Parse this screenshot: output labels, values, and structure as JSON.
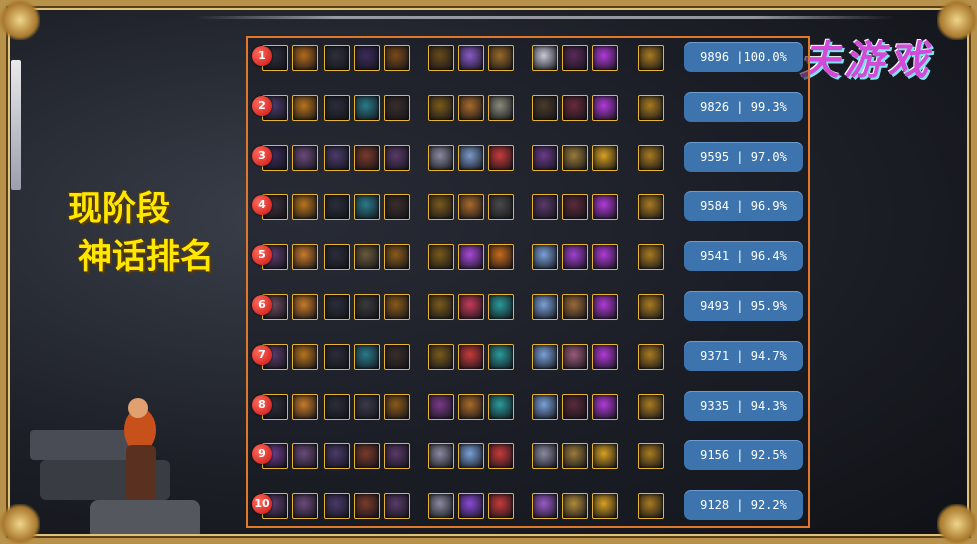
{
  "brand": {
    "text": "夫游戏"
  },
  "side_title": {
    "line1": "现阶段",
    "line2": "神话排名"
  },
  "colors": {
    "frame_gold": "#b8924a",
    "panel_border": "#e0772a",
    "score_bg": "#3d74ad",
    "title_yellow": "#ffe800",
    "rank_badge": "#c81414"
  },
  "rows": [
    {
      "rank": "1",
      "score": "9896 |100.0%"
    },
    {
      "rank": "2",
      "score": "9826 | 99.3%"
    },
    {
      "rank": "3",
      "score": "9595 | 97.0%"
    },
    {
      "rank": "4",
      "score": "9584 | 96.9%"
    },
    {
      "rank": "5",
      "score": "9541 | 96.4%"
    },
    {
      "rank": "6",
      "score": "9493 | 95.9%"
    },
    {
      "rank": "7",
      "score": "9371 | 94.7%"
    },
    {
      "rank": "8",
      "score": "9335 | 94.3%"
    },
    {
      "rank": "9",
      "score": "9156 | 92.5%"
    },
    {
      "rank": "10",
      "score": "9128 | 92.2%"
    }
  ],
  "item_palettes": [
    [
      "#2a2d3a",
      "#b36a1c",
      "#2d2f3a",
      "#3a2b5a",
      "#7a4a1a",
      "#6a4a18",
      "#8a5ac8",
      "#9a6a28",
      "#c8c8d8",
      "#5a2a5a",
      "#b03ad8",
      "#a87a20"
    ],
    [
      "#4a3a6a",
      "#b8741c",
      "#2a2d3a",
      "#2a7a8a",
      "#3a2d2a",
      "#7a5a1a",
      "#a86a2a",
      "#8a8a7a",
      "#4a3a2a",
      "#6a2a3a",
      "#b03ad8",
      "#a87a20"
    ],
    [
      "#3a2a5a",
      "#6a4a7a",
      "#4a3a6a",
      "#7a3a2a",
      "#5a3a6a",
      "#8a8aa0",
      "#7a9ac8",
      "#c83a3a",
      "#6a3a8a",
      "#9a7a3a",
      "#d8a020",
      "#a87a20"
    ],
    [
      "#3a2d3a",
      "#b8741c",
      "#2a2d3a",
      "#2a7a8a",
      "#3a2d2a",
      "#7a5a1a",
      "#a86a2a",
      "#4a4a4a",
      "#5a3a6a",
      "#5a2a3a",
      "#b03ad8",
      "#a87a20"
    ],
    [
      "#5a3a6a",
      "#c87a2a",
      "#2a2d3a",
      "#6a5a3a",
      "#8a5a1a",
      "#7a5a1a",
      "#a84ad8",
      "#c86a1a",
      "#7aa0d8",
      "#a040d0",
      "#b03ad8",
      "#a87a20"
    ],
    [
      "#6a4a5a",
      "#c87a2a",
      "#2a2d3a",
      "#3a3a3a",
      "#8a5a1a",
      "#7a5a1a",
      "#c83a5a",
      "#2a9a9a",
      "#7aa0d8",
      "#9a6a3a",
      "#b03ad8",
      "#a87a20"
    ],
    [
      "#5a3a6a",
      "#b8741c",
      "#2a2d3a",
      "#2a7a8a",
      "#3a2d2a",
      "#7a5a1a",
      "#c83a3a",
      "#2a9a9a",
      "#7aa0d8",
      "#9a5a7a",
      "#b03ad8",
      "#a87a20"
    ],
    [
      "#2a2d3a",
      "#c87a2a",
      "#2a2d3a",
      "#3a3a4a",
      "#8a5a1a",
      "#7a3a8a",
      "#a86a2a",
      "#2a9a9a",
      "#7aa0d8",
      "#5a2a3a",
      "#b03ad8",
      "#a87a20"
    ],
    [
      "#6a3a8a",
      "#6a4a7a",
      "#4a3a6a",
      "#7a3a2a",
      "#5a3a6a",
      "#8a8aa0",
      "#7aa0d8",
      "#c83a3a",
      "#8a8aa0",
      "#9a7a3a",
      "#d8a020",
      "#a87a20"
    ],
    [
      "#5a3a6a",
      "#6a4a7a",
      "#4a3a6a",
      "#7a3a2a",
      "#5a3a6a",
      "#8a8aa0",
      "#8a4ad8",
      "#c83a3a",
      "#9a5ac8",
      "#b08a3a",
      "#d8a020",
      "#a87a20"
    ]
  ]
}
